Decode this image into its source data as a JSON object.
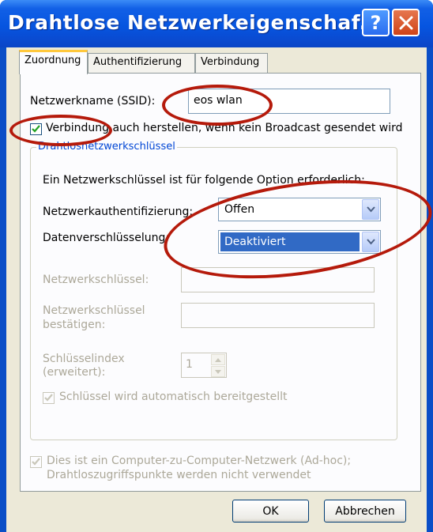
{
  "window": {
    "title": "Drahtlose Netzwerkeigenschaf...",
    "help_button": "?",
    "close_button": "✕"
  },
  "tabs": [
    {
      "label": "Zuordnung",
      "active": true
    },
    {
      "label": "Authentifizierung",
      "active": false
    },
    {
      "label": "Verbindung",
      "active": false
    }
  ],
  "ssid": {
    "label": "Netzwerkname (SSID):",
    "value": "eos wlan"
  },
  "broadcast_checkbox": {
    "label": "Verbindung auch herstellen, wenn kein Broadcast gesendet wird",
    "checked": true
  },
  "key_group": {
    "legend": "Drahtlosnetzwerkschlüssel",
    "intro": "Ein Netzwerkschlüssel ist für folgende Option erforderlich:",
    "auth": {
      "label": "Netzwerkauthentifizierung:",
      "value": "Offen"
    },
    "encryption": {
      "label": "Datenverschlüsselung:",
      "value": "Deaktiviert"
    },
    "network_key": {
      "label": "Netzwerkschlüssel:",
      "value": ""
    },
    "confirm_key": {
      "label_line1": "Netzwerkschlüssel",
      "label_line2": "bestätigen:",
      "value": ""
    },
    "key_index": {
      "label_line1": "Schlüsselindex",
      "label_line2": "(erweitert):",
      "value": "1"
    },
    "auto_key": {
      "label": "Schlüssel wird automatisch bereitgestellt",
      "checked": true,
      "enabled": false
    }
  },
  "adhoc": {
    "label_line1": "Dies ist ein Computer-zu-Computer-Netzwerk (Ad-hoc);",
    "label_line2": "Drahtloszugriffspunkte werden nicht verwendet",
    "checked": true,
    "enabled": false
  },
  "buttons": {
    "ok": "OK",
    "cancel": "Abbrechen"
  },
  "colors": {
    "titlebar": "#0a4ec7",
    "dialog_face": "#ece9d8",
    "group_legend": "#0046d5",
    "annotation_ring": "#b51a0b",
    "selection": "#316ac5"
  }
}
